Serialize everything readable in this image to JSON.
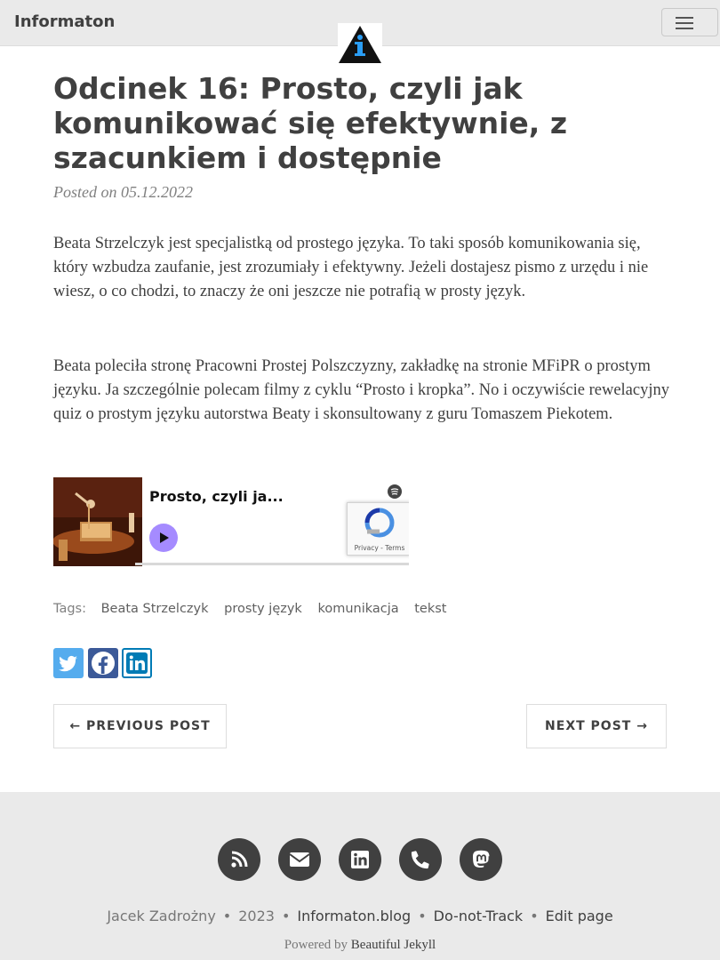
{
  "navbar": {
    "brand": "Informaton",
    "menu_icon": "hamburger-icon",
    "logo_icon": "info-triangle-logo"
  },
  "post": {
    "title": "Odcinek 16: Prosto, czyli jak komunikować się efektywnie, z szacunkiem i dostępnie",
    "meta": "Posted on 05.12.2022",
    "paragraph_1": "Beata Strzelczyk jest specjalistką od prostego języka. To taki sposób komunikowania się, który wzbudza zaufanie, jest zrozumiały i efektywny. Jeżeli dostajesz pismo z urzędu i nie wiesz, o co chodzi, to znaczy że oni jeszcze nie potrafią w prosty język.",
    "paragraph_2": "Beata poleciła stronę Pracowni Prostej Polszczyzny, zakładkę na stronie MFiPR o prostym języku. Ja szczególnie polecam filmy z cyklu “Prosto i kropka”. No i oczywiście rewelacyjny quiz o prostym języku autorstwa Beaty i skonsultowany z guru Tomaszem Piekotem."
  },
  "embed": {
    "episode_title": "Prosto, czyli ja...",
    "recaptcha_terms": "Privacy - Terms"
  },
  "tags": {
    "label": "Tags:",
    "items": [
      "Beata Strzelczyk",
      "prosty język",
      "komunikacja",
      "tekst"
    ]
  },
  "share": {
    "twitter": "twitter-icon",
    "facebook": "facebook-icon",
    "linkedin": "linkedin-icon"
  },
  "pager": {
    "previous": "← PREVIOUS POST",
    "next": "NEXT POST →"
  },
  "footer": {
    "author": "Jacek Zadrożny",
    "year": "2023",
    "site": "Informaton.blog",
    "dnt": "Do-not-Track",
    "edit": "Edit page",
    "separator": "•",
    "powered_prefix": "Powered by",
    "powered_link": "Beautiful Jekyll",
    "icons": [
      "rss-icon",
      "email-icon",
      "linkedin-icon",
      "phone-icon",
      "mastodon-icon"
    ]
  },
  "colors": {
    "navbar_bg": "#eaeaea",
    "text": "#404040",
    "muted": "#808080",
    "twitter": "#55acee",
    "facebook": "#3b5998",
    "linkedin": "#007bb5",
    "play_button": "#a58bff"
  }
}
